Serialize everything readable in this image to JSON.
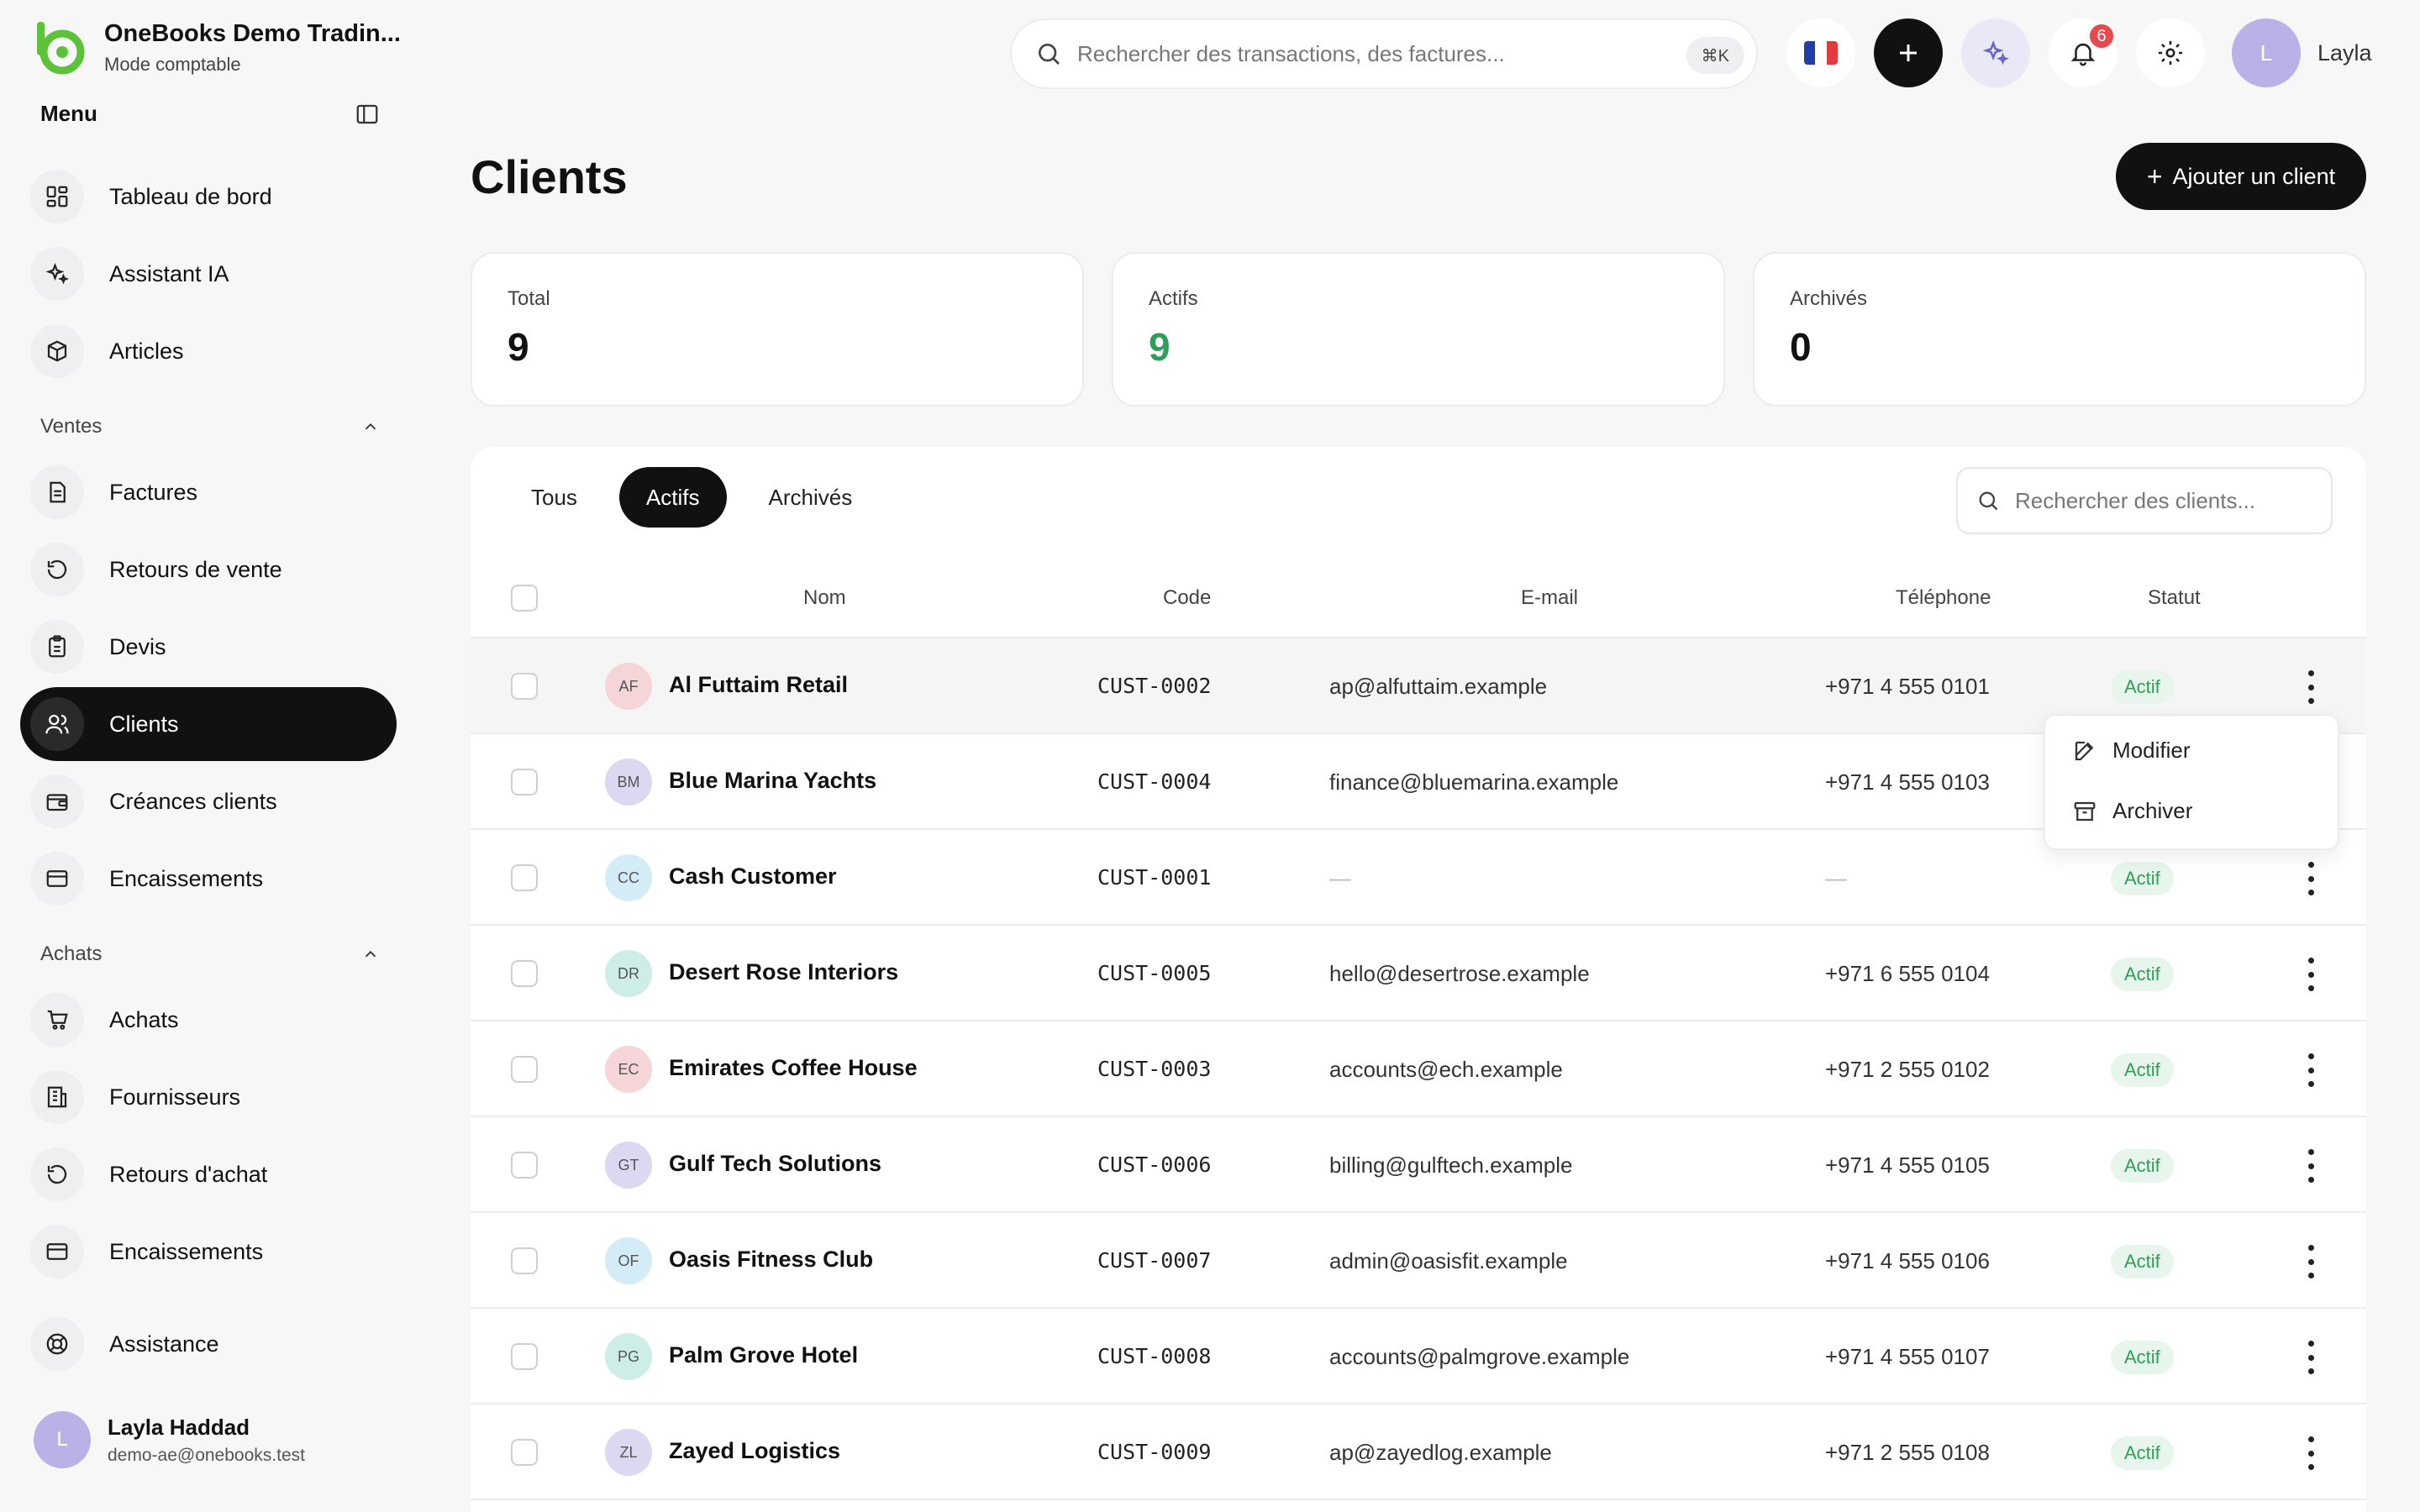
{
  "brand": {
    "title": "OneBooks Demo Tradin...",
    "subtitle": "Mode comptable"
  },
  "sidebar": {
    "menu_label": "Menu",
    "top_items": [
      {
        "label": "Tableau de bord",
        "icon": "dashboard-icon"
      },
      {
        "label": "Assistant IA",
        "icon": "sparkles-icon"
      },
      {
        "label": "Articles",
        "icon": "box-icon"
      }
    ],
    "sales_section": "Ventes",
    "sales_items": [
      {
        "label": "Factures",
        "icon": "invoice-icon"
      },
      {
        "label": "Retours de vente",
        "icon": "return-icon"
      },
      {
        "label": "Devis",
        "icon": "clipboard-icon"
      },
      {
        "label": "Clients",
        "icon": "users-icon",
        "active": true
      },
      {
        "label": "Créances clients",
        "icon": "wallet-icon"
      },
      {
        "label": "Encaissements",
        "icon": "card-icon"
      }
    ],
    "purchases_section": "Achats",
    "purchase_items": [
      {
        "label": "Achats",
        "icon": "cart-icon"
      },
      {
        "label": "Fournisseurs",
        "icon": "building-icon"
      },
      {
        "label": "Retours d'achat",
        "icon": "return-icon"
      },
      {
        "label": "Encaissements",
        "icon": "card-icon"
      }
    ],
    "support_item": {
      "label": "Assistance",
      "icon": "lifebuoy-icon"
    },
    "user": {
      "initial": "L",
      "name": "Layla Haddad",
      "email": "demo-ae@onebooks.test"
    }
  },
  "topbar": {
    "search_placeholder": "Rechercher des transactions, des factures...",
    "shortcut": "⌘K",
    "notifications_count": "6",
    "user_initial": "L",
    "user_name": "Layla"
  },
  "page": {
    "title": "Clients",
    "add_button": "Ajouter un client"
  },
  "stats": [
    {
      "label": "Total",
      "value": "9",
      "color": "#111111"
    },
    {
      "label": "Actifs",
      "value": "9",
      "color": "#2f9e58"
    },
    {
      "label": "Archivés",
      "value": "0",
      "color": "#111111"
    }
  ],
  "tabs": [
    {
      "label": "Tous",
      "active": false
    },
    {
      "label": "Actifs",
      "active": true
    },
    {
      "label": "Archivés",
      "active": false
    }
  ],
  "table_search_placeholder": "Rechercher des clients...",
  "columns": {
    "name": "Nom",
    "code": "Code",
    "email": "E-mail",
    "phone": "Téléphone",
    "status": "Statut"
  },
  "rows": [
    {
      "initials": "AF",
      "avatar_color": "#f6d5d8",
      "name": "Al Futtaim Retail",
      "code": "CUST-0002",
      "email": "ap@alfuttaim.example",
      "phone": "+971 4 555 0101",
      "status": "Actif"
    },
    {
      "initials": "BM",
      "avatar_color": "#dcd8f2",
      "name": "Blue Marina Yachts",
      "code": "CUST-0004",
      "email": "finance@bluemarina.example",
      "phone": "+971 4 555 0103",
      "status": "Actif"
    },
    {
      "initials": "CC",
      "avatar_color": "#d4ecf6",
      "name": "Cash Customer",
      "code": "CUST-0001",
      "email": "—",
      "phone": "—",
      "status": "Actif"
    },
    {
      "initials": "DR",
      "avatar_color": "#cdeee6",
      "name": "Desert Rose Interiors",
      "code": "CUST-0005",
      "email": "hello@desertrose.example",
      "phone": "+971 6 555 0104",
      "status": "Actif"
    },
    {
      "initials": "EC",
      "avatar_color": "#f6d5d8",
      "name": "Emirates Coffee House",
      "code": "CUST-0003",
      "email": "accounts@ech.example",
      "phone": "+971 2 555 0102",
      "status": "Actif"
    },
    {
      "initials": "GT",
      "avatar_color": "#dcd8f2",
      "name": "Gulf Tech Solutions",
      "code": "CUST-0006",
      "email": "billing@gulftech.example",
      "phone": "+971 4 555 0105",
      "status": "Actif"
    },
    {
      "initials": "OF",
      "avatar_color": "#d4ecf6",
      "name": "Oasis Fitness Club",
      "code": "CUST-0007",
      "email": "admin@oasisfit.example",
      "phone": "+971 4 555 0106",
      "status": "Actif"
    },
    {
      "initials": "PG",
      "avatar_color": "#cdeee6",
      "name": "Palm Grove Hotel",
      "code": "CUST-0008",
      "email": "accounts@palmgrove.example",
      "phone": "+971 4 555 0107",
      "status": "Actif"
    },
    {
      "initials": "ZL",
      "avatar_color": "#dcd8f2",
      "name": "Zayed Logistics",
      "code": "CUST-0009",
      "email": "ap@zayedlog.example",
      "phone": "+971 2 555 0108",
      "status": "Actif"
    }
  ],
  "row_menu": {
    "edit": "Modifier",
    "archive": "Archiver"
  }
}
